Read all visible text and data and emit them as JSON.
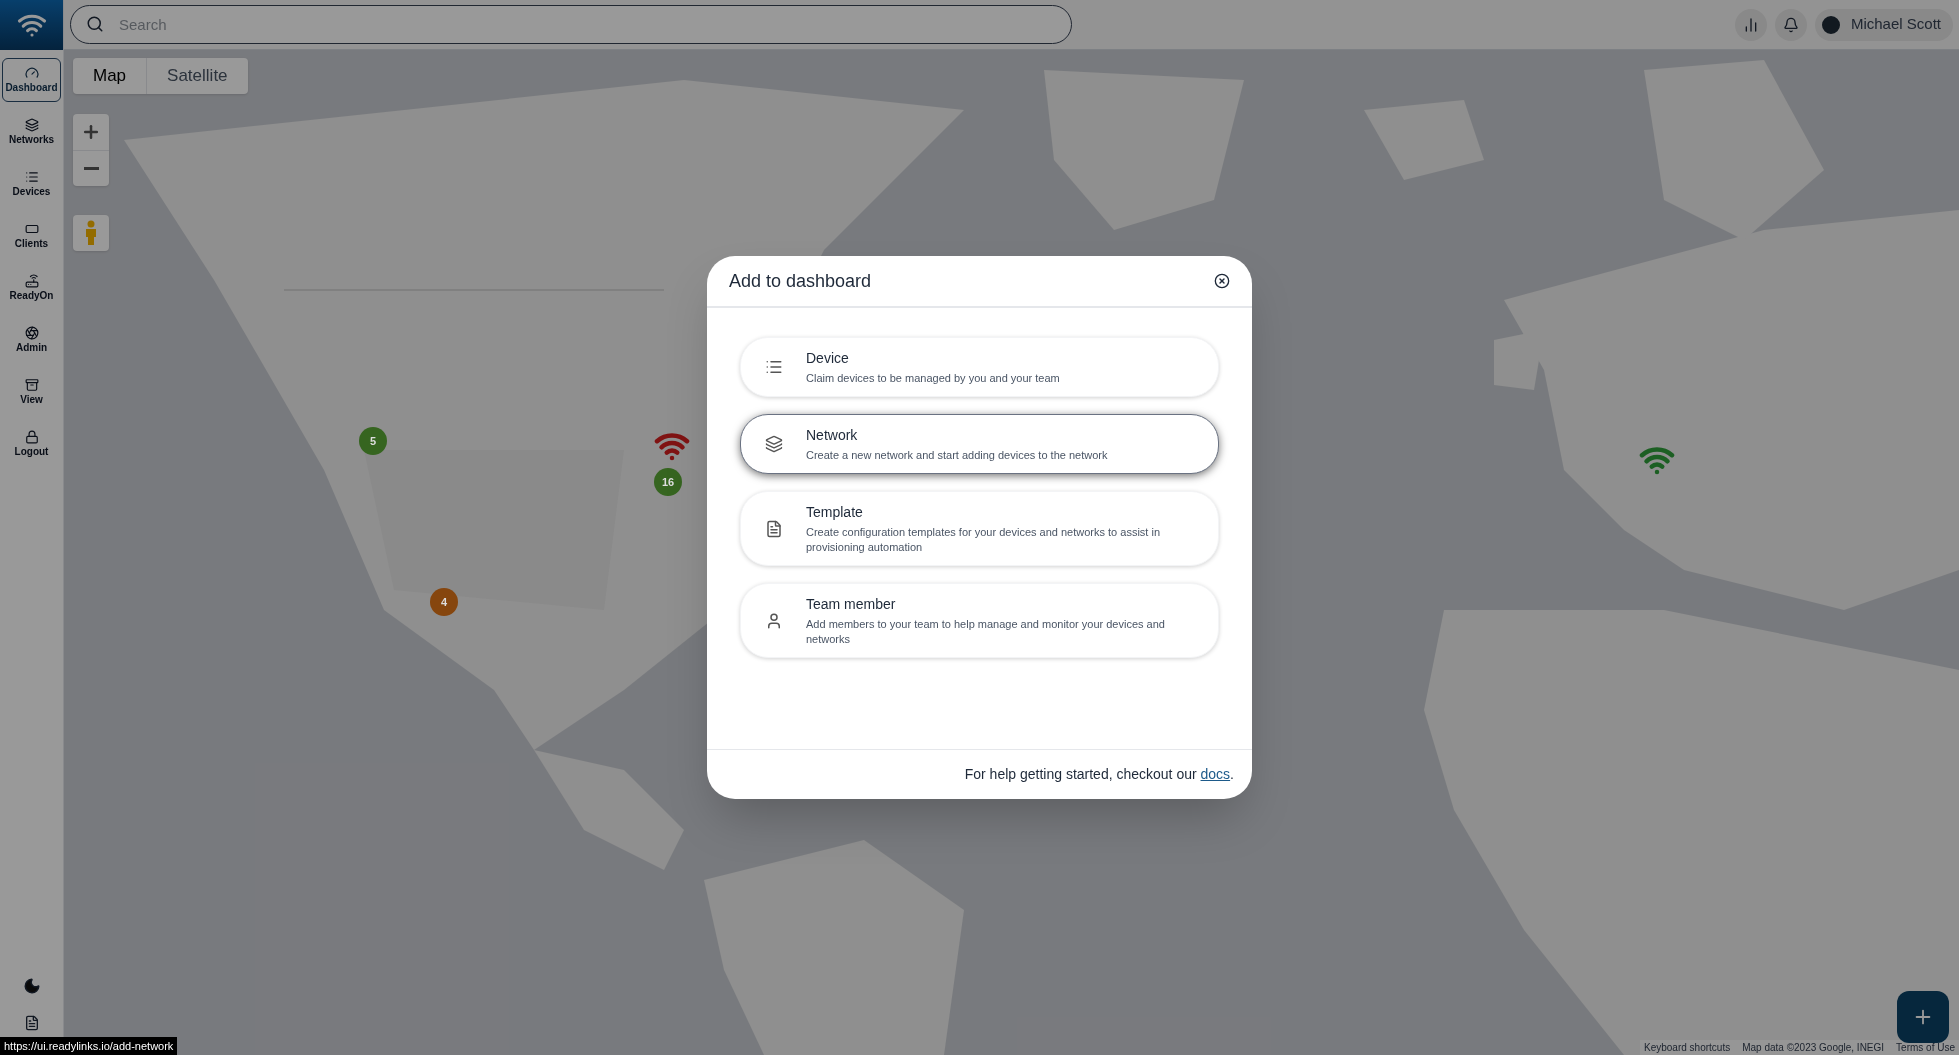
{
  "top_bar": {
    "search": {
      "placeholder": "Search"
    },
    "user": {
      "name": "Michael Scott"
    }
  },
  "sidebar": {
    "items": [
      {
        "label": "Dashboard",
        "selected": true
      },
      {
        "label": "Networks",
        "selected": false
      },
      {
        "label": "Devices",
        "selected": false
      },
      {
        "label": "Clients",
        "selected": false
      },
      {
        "label": "ReadyOn",
        "selected": false
      },
      {
        "label": "Admin",
        "selected": false
      },
      {
        "label": "View",
        "selected": false
      },
      {
        "label": "Logout",
        "selected": false
      }
    ]
  },
  "map": {
    "map_types": [
      {
        "label": "Map",
        "selected": true
      },
      {
        "label": "Satellite",
        "selected": false
      }
    ],
    "markers": [
      {
        "kind": "cluster",
        "count": "5",
        "color": "#366520"
      },
      {
        "kind": "wifi",
        "color": "#801313"
      },
      {
        "kind": "cluster",
        "count": "16",
        "color": "#366520"
      },
      {
        "kind": "cluster",
        "count": "4",
        "color": "#86460e"
      },
      {
        "kind": "wifi",
        "color": "#1c5f23"
      }
    ],
    "attribution": [
      "Keyboard shortcuts",
      "Map data ©2023 Google, INEGI",
      "Terms of Use"
    ]
  },
  "dialog": {
    "title": "Add to dashboard",
    "options": [
      {
        "title": "Device",
        "description": "Claim devices to be managed by you and your team",
        "selected": false
      },
      {
        "title": "Network",
        "description": "Create a new network and start adding devices to the network",
        "selected": true
      },
      {
        "title": "Template",
        "description": "Create configuration templates for your devices and networks to assist in provisioning automation",
        "selected": false
      },
      {
        "title": "Team member",
        "description": "Add members to your team to help manage and monitor your devices and networks",
        "selected": false
      }
    ],
    "footer": {
      "text": "For help getting started, checkout our ",
      "link": "docs",
      "end": "."
    }
  },
  "status_url": "https://ui.readylinks.io/add-network"
}
